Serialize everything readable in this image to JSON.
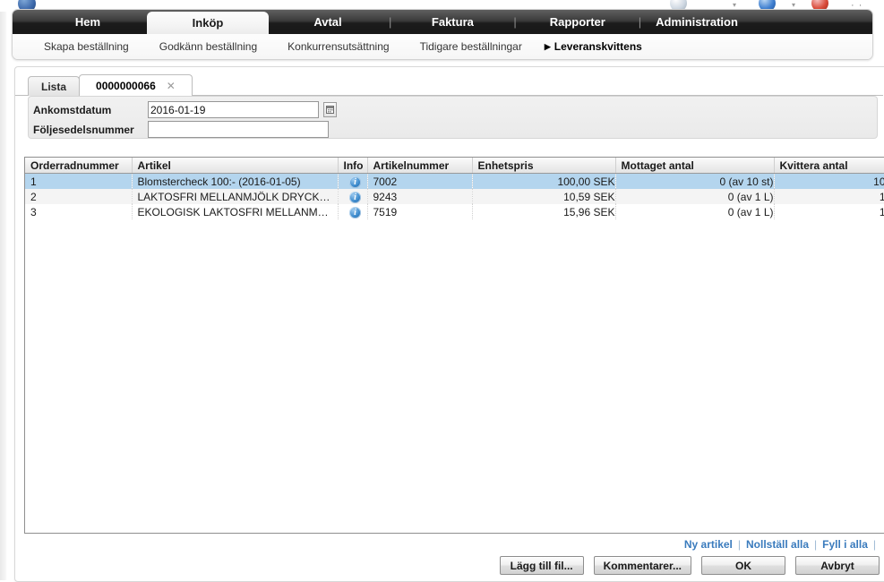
{
  "browser": {
    "logo_icon": "app-logo-icon",
    "address_placeholder_text": "",
    "buttons": [
      {
        "icon": "search-globe-icon",
        "kind": "gray"
      },
      {
        "icon": "back-arrow-icon",
        "kind": "blue"
      },
      {
        "icon": "stop-icon",
        "kind": "red"
      }
    ],
    "dots": "· ·"
  },
  "primary_nav": {
    "items": [
      {
        "label": "Hem",
        "active": false
      },
      {
        "label": "Inköp",
        "active": true
      },
      {
        "label": "Avtal",
        "active": false
      },
      {
        "label": "Faktura",
        "active": false
      },
      {
        "label": "Rapporter",
        "active": false
      },
      {
        "label": "Administration",
        "active": false
      }
    ],
    "separator": "|"
  },
  "secondary_nav": {
    "items": [
      {
        "label": "Skapa beställning",
        "active": false
      },
      {
        "label": "Godkänn beställning",
        "active": false
      },
      {
        "label": "Konkurrensutsättning",
        "active": false
      },
      {
        "label": "Tidigare beställningar",
        "active": false
      },
      {
        "label": "Leveranskvittens",
        "active": true
      }
    ],
    "active_arrow": "▶"
  },
  "tabs": [
    {
      "label": "Lista",
      "active": false,
      "closable": false
    },
    {
      "label": "0000000066",
      "active": true,
      "closable": true,
      "close_label": "✕"
    }
  ],
  "form": {
    "ankomstdatum_label": "Ankomstdatum",
    "ankomstdatum_value": "2016-01-19",
    "ankomstdatum_placeholder": "",
    "calendar_icon": "calendar-icon",
    "foljesedelsnummer_label": "Följesedelsnummer",
    "foljesedelsnummer_value": "",
    "foljesedelsnummer_placeholder": ""
  },
  "grid": {
    "columns": [
      "Orderradnummer",
      "Artikel",
      "Info",
      "Artikelnummer",
      "Enhetspris",
      "Mottaget antal",
      "Kvittera antal"
    ],
    "rows": [
      {
        "orderradnummer": "1",
        "artikel": "Blomstercheck 100:- (2016-01-05)",
        "info_icon": "info-icon",
        "info_glyph": "i",
        "artikelnummer": "7002",
        "enhetspris": "100,00 SEK",
        "mottaget_antal": "0 (av 10 st)",
        "kvittera_antal": "10",
        "selected": true
      },
      {
        "orderradnummer": "2",
        "artikel": "LAKTOSFRI MELLANMJÖLK DRYCK…",
        "info_icon": "info-icon",
        "info_glyph": "i",
        "artikelnummer": "9243",
        "enhetspris": "10,59 SEK",
        "mottaget_antal": "0 (av 1 L)",
        "kvittera_antal": "1",
        "selected": false
      },
      {
        "orderradnummer": "3",
        "artikel": "EKOLOGISK LAKTOSFRI MELLANM…",
        "info_icon": "info-icon",
        "info_glyph": "i",
        "artikelnummer": "7519",
        "enhetspris": "15,96 SEK",
        "mottaget_antal": "0 (av 1 L)",
        "kvittera_antal": "1",
        "selected": false
      }
    ]
  },
  "footer": {
    "links": [
      {
        "label": "Ny artikel"
      },
      {
        "label": "Nollställ alla"
      },
      {
        "label": "Fyll i alla"
      }
    ],
    "link_separator": "|",
    "buttons": [
      {
        "label": "Lägg till fil..."
      },
      {
        "label": "Kommentarer..."
      },
      {
        "label": "OK"
      },
      {
        "label": "Avbryt"
      }
    ]
  },
  "colors": {
    "accent_link": "#3a7bbd",
    "row_selected": "#b4d5ee",
    "nav_bar": "#1c1c1c",
    "info_icon": "#3d8bcd"
  }
}
